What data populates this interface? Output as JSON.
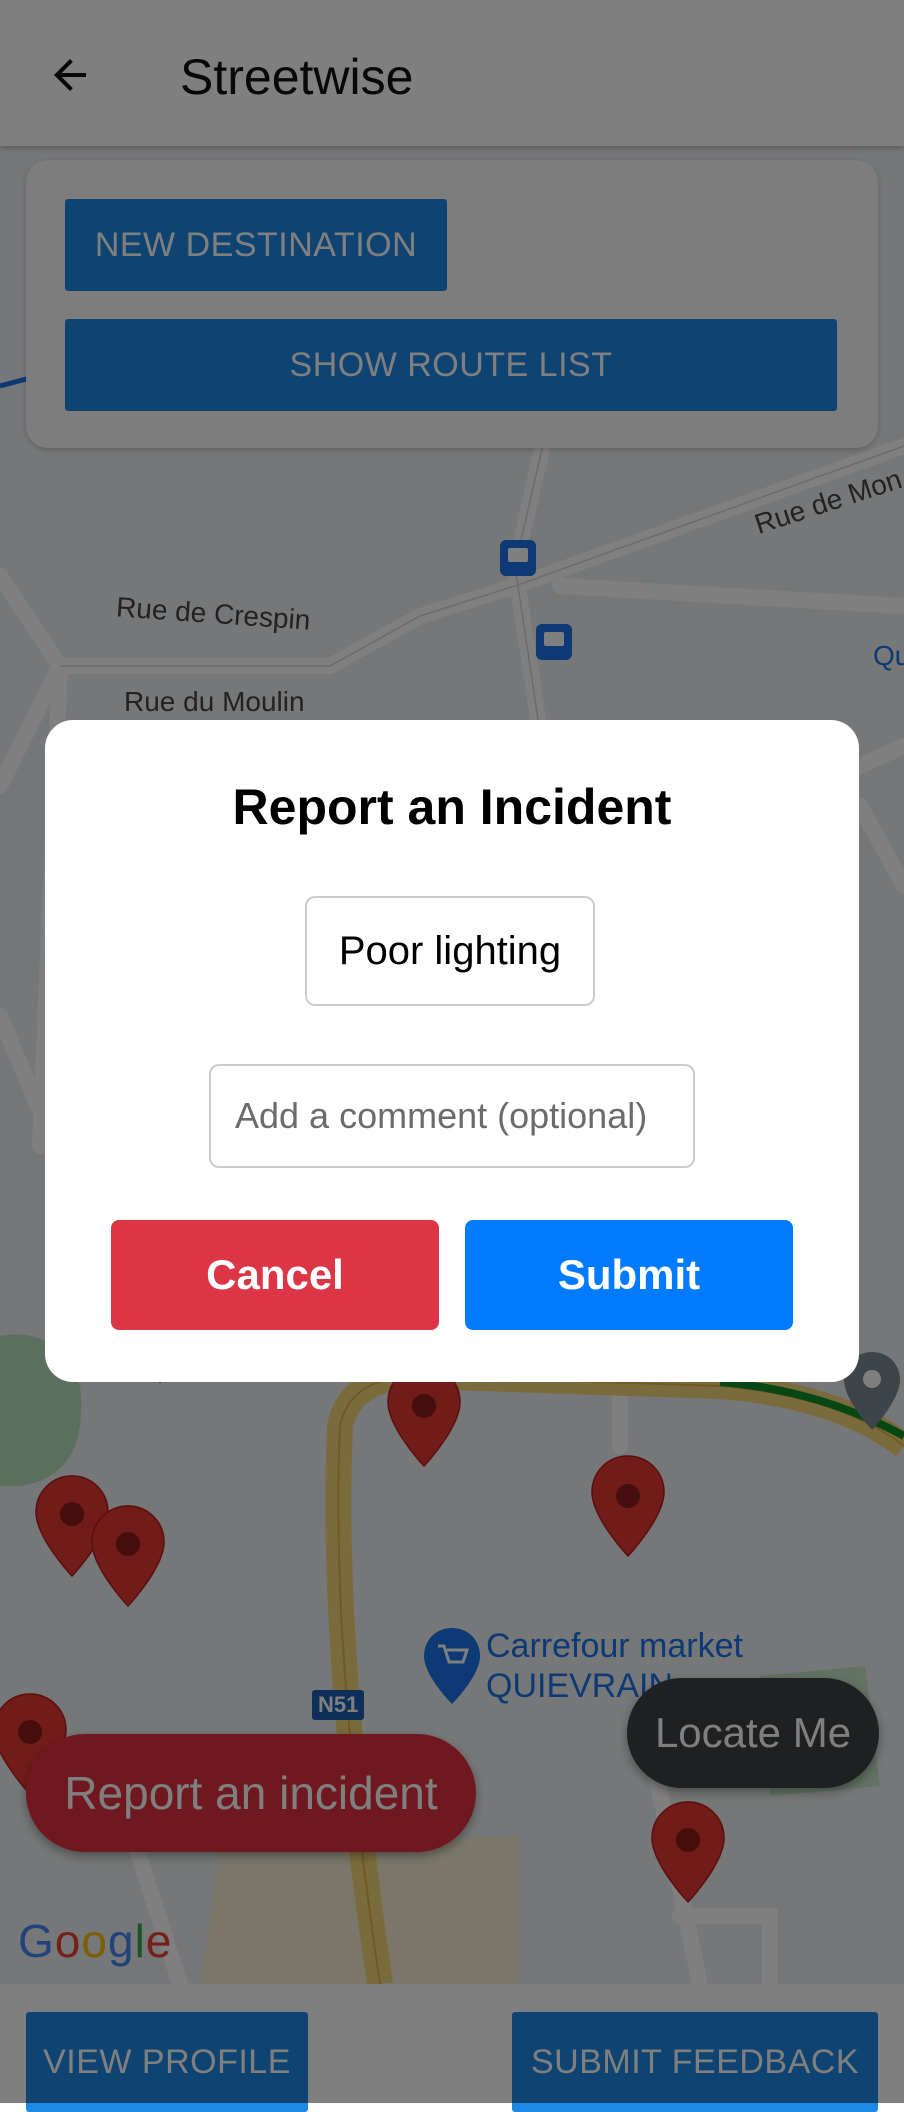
{
  "app_bar": {
    "title": "Streetwise",
    "back_icon": "arrow-left-icon"
  },
  "top_panel": {
    "new_destination_label": "NEW DESTINATION",
    "show_route_list_label": "SHOW ROUTE LIST"
  },
  "map": {
    "street_labels": [
      "Rue de Mon",
      "Rue de Crespin",
      "Rue du Moulin",
      "Qu"
    ],
    "road_shield": "N51",
    "poi": {
      "name_line1": "Carrefour market",
      "name_line2": "QUIEVRAIN",
      "icon": "shopping-cart-icon"
    },
    "logo_text": "Google"
  },
  "fab": {
    "report_label": "Report an incident",
    "locate_label": "Locate Me"
  },
  "bottom_bar": {
    "view_profile_label": "VIEW PROFILE",
    "submit_feedback_label": "SUBMIT FEEDBACK"
  },
  "dialog": {
    "title": "Report an Incident",
    "incident_type": "Poor lighting",
    "comment_placeholder": "Add a comment (optional)",
    "cancel_label": "Cancel",
    "submit_label": "Submit"
  },
  "colors": {
    "primary_blue": "#1e88e5",
    "cancel_red": "#dc3545",
    "submit_blue": "#007bff",
    "report_red": "#e0313f",
    "locate_dark": "#3c4043"
  }
}
